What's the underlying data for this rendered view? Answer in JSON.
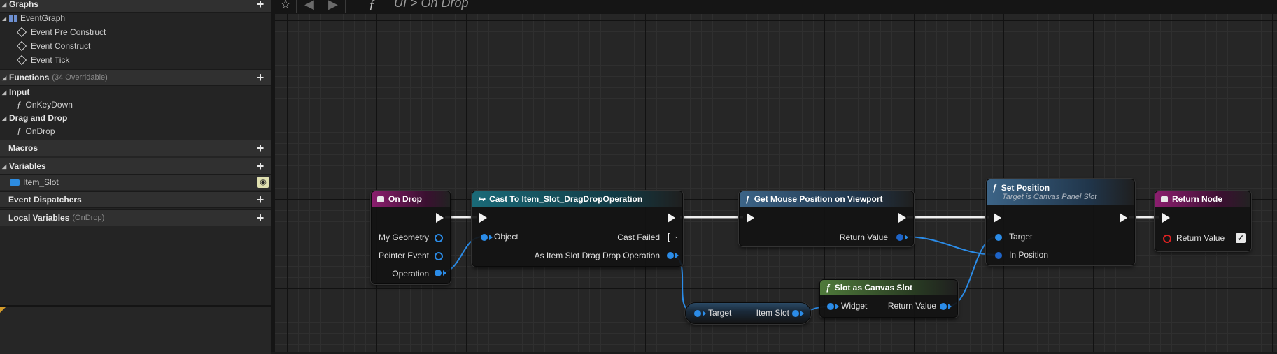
{
  "panel": {
    "graphs": {
      "label": "Graphs",
      "event_graph": "EventGraph",
      "events": [
        "Event Pre Construct",
        "Event Construct",
        "Event Tick"
      ]
    },
    "functions": {
      "label": "Functions",
      "count": "(34 Overridable)"
    },
    "input": {
      "label": "Input",
      "item": "OnKeyDown"
    },
    "drag_drop": {
      "label": "Drag and Drop",
      "item": "OnDrop"
    },
    "macros": {
      "label": "Macros"
    },
    "variables": {
      "label": "Variables",
      "item": "Item_Slot"
    },
    "dispatchers": {
      "label": "Event Dispatchers"
    },
    "local_vars": {
      "label": "Local Variables",
      "scope": "(OnDrop)"
    }
  },
  "breadcrumb": {
    "text": "UI > On Drop"
  },
  "nodes": {
    "on_drop": {
      "title": "On Drop",
      "pins": [
        "My Geometry",
        "Pointer Event",
        "Operation"
      ]
    },
    "cast": {
      "title": "Cast To Item_Slot_DragDropOperation",
      "object": "Object",
      "cast_failed": "Cast Failed",
      "as_item": "As Item Slot Drag Drop Operation"
    },
    "get_mouse": {
      "title": "Get Mouse Position on Viewport",
      "return": "Return Value"
    },
    "set_position": {
      "title": "Set Position",
      "subtitle": "Target is Canvas Panel Slot",
      "target": "Target",
      "in_position": "In Position"
    },
    "return_node": {
      "title": "Return Node",
      "return": "Return Value"
    },
    "get_item": {
      "target": "Target",
      "item_slot": "Item Slot"
    },
    "slot_canvas": {
      "title": "Slot as Canvas Slot",
      "widget": "Widget",
      "return": "Return Value"
    }
  },
  "colors": {
    "event_header": "#8b1e6e",
    "cast_header": "#1a6a78",
    "func_header": "#3c6487",
    "pure_header": "#4f7a3b",
    "object_pin": "#2b8ce8",
    "bool_pin": "#dd2222"
  }
}
